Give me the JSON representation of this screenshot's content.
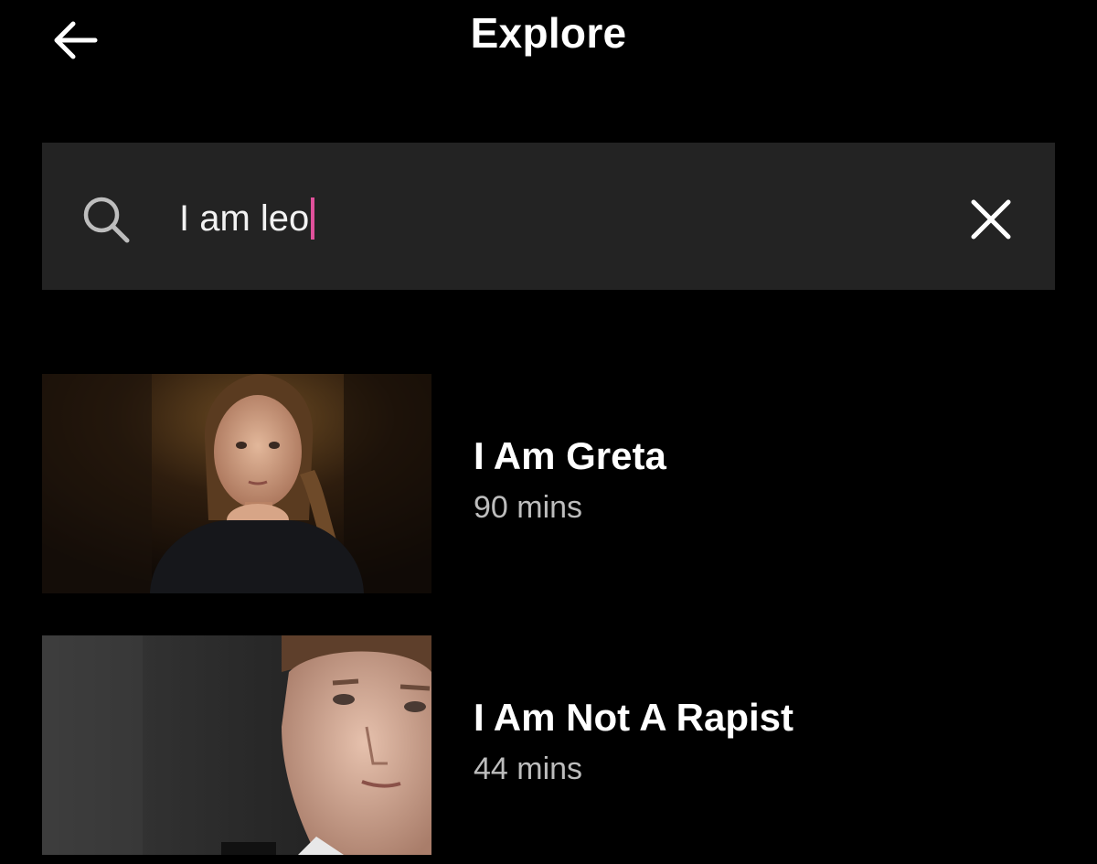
{
  "header": {
    "title": "Explore",
    "back_icon": "arrow-left-icon"
  },
  "search": {
    "value": "I am leo",
    "search_icon": "search-icon",
    "clear_icon": "close-icon",
    "caret_color": "#e0519b"
  },
  "results": [
    {
      "title": "I Am Greta",
      "duration": "90 mins"
    },
    {
      "title": "I Am Not A Rapist",
      "duration": "44 mins"
    }
  ],
  "colors": {
    "background": "#000000",
    "search_bar": "#232323",
    "text_primary": "#ffffff",
    "text_secondary": "#bdbdbd",
    "accent": "#e0519b"
  }
}
